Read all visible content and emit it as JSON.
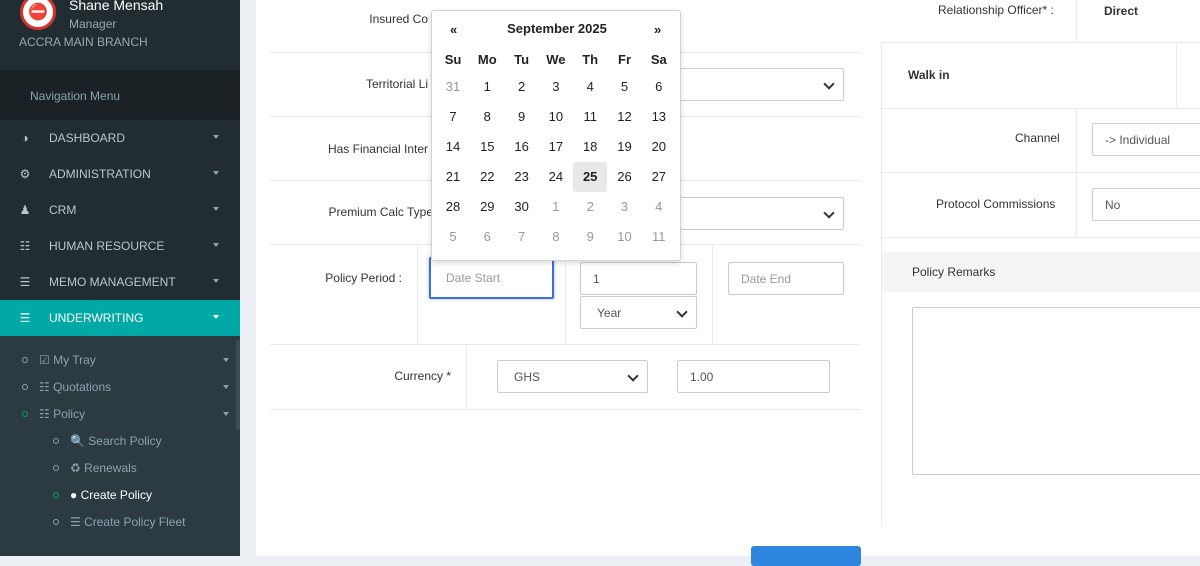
{
  "user": {
    "name": "Shane Mensah",
    "role": "Manager",
    "branch": "ACCRA MAIN BRANCH",
    "avatar_text": "⛔"
  },
  "sidebar": {
    "nav_header": "Navigation Menu",
    "items": [
      {
        "label": "DASHBOARD",
        "icon": "dashboard-icon",
        "glyph": "◑"
      },
      {
        "label": "ADMINISTRATION",
        "icon": "gear-icon",
        "glyph": "⚙"
      },
      {
        "label": "CRM",
        "icon": "user-icon",
        "glyph": "♟"
      },
      {
        "label": "HUMAN RESOURCE",
        "icon": "users-icon",
        "glyph": "☷"
      },
      {
        "label": "MEMO MANAGEMENT",
        "icon": "memo-icon",
        "glyph": "☰"
      },
      {
        "label": "UNDERWRITING",
        "icon": "list-icon",
        "glyph": "☰"
      }
    ],
    "sub_items": [
      {
        "label": "☑ My Tray"
      },
      {
        "label": "☷ Quotations"
      },
      {
        "label": "☷ Policy"
      },
      {
        "label": "🔍 Search Policy"
      },
      {
        "label": "♻ Renewals"
      },
      {
        "label": "● Create Policy"
      },
      {
        "label": "☰ Create Policy Fleet"
      }
    ]
  },
  "form": {
    "insured_label": "Insured Co",
    "territorial_label": "Territorial Li",
    "financial_label": "Has Financial Inter",
    "premium_label": "Premium Calc Type",
    "policy_period_label": "Policy Period :",
    "date_start_placeholder": "Date Start",
    "duration_value": "1",
    "duration_unit": "Year",
    "date_end_placeholder": "Date End",
    "currency_label": "Currency *",
    "currency_value": "GHS",
    "rate_value": "1.00"
  },
  "right_panel": {
    "relationship_officer_label": "Relationship Officer* :",
    "relationship_officer_value": "Direct",
    "walk_in_label": "Walk in",
    "channel_label": "Channel",
    "channel_value": "-> Individual",
    "protocol_label": "Protocol Commissions",
    "protocol_value": "No",
    "remarks_header": "Policy Remarks"
  },
  "datepicker": {
    "prev": "«",
    "next": "»",
    "title": "September 2025",
    "weekdays": [
      "Su",
      "Mo",
      "Tu",
      "We",
      "Th",
      "Fr",
      "Sa"
    ],
    "weeks": [
      [
        "31",
        "1",
        "2",
        "3",
        "4",
        "5",
        "6"
      ],
      [
        "7",
        "8",
        "9",
        "10",
        "11",
        "12",
        "13"
      ],
      [
        "14",
        "15",
        "16",
        "17",
        "18",
        "19",
        "20"
      ],
      [
        "21",
        "22",
        "23",
        "24",
        "25",
        "26",
        "27"
      ],
      [
        "28",
        "29",
        "30",
        "1",
        "2",
        "3",
        "4"
      ],
      [
        "5",
        "6",
        "7",
        "8",
        "9",
        "10",
        "11"
      ]
    ],
    "today": "25"
  },
  "colors": {
    "sidebar_bg": "#222d32",
    "active_menu": "#00a9a6",
    "focus_border": "#3b6fd9",
    "primary_button": "#2e86de"
  }
}
